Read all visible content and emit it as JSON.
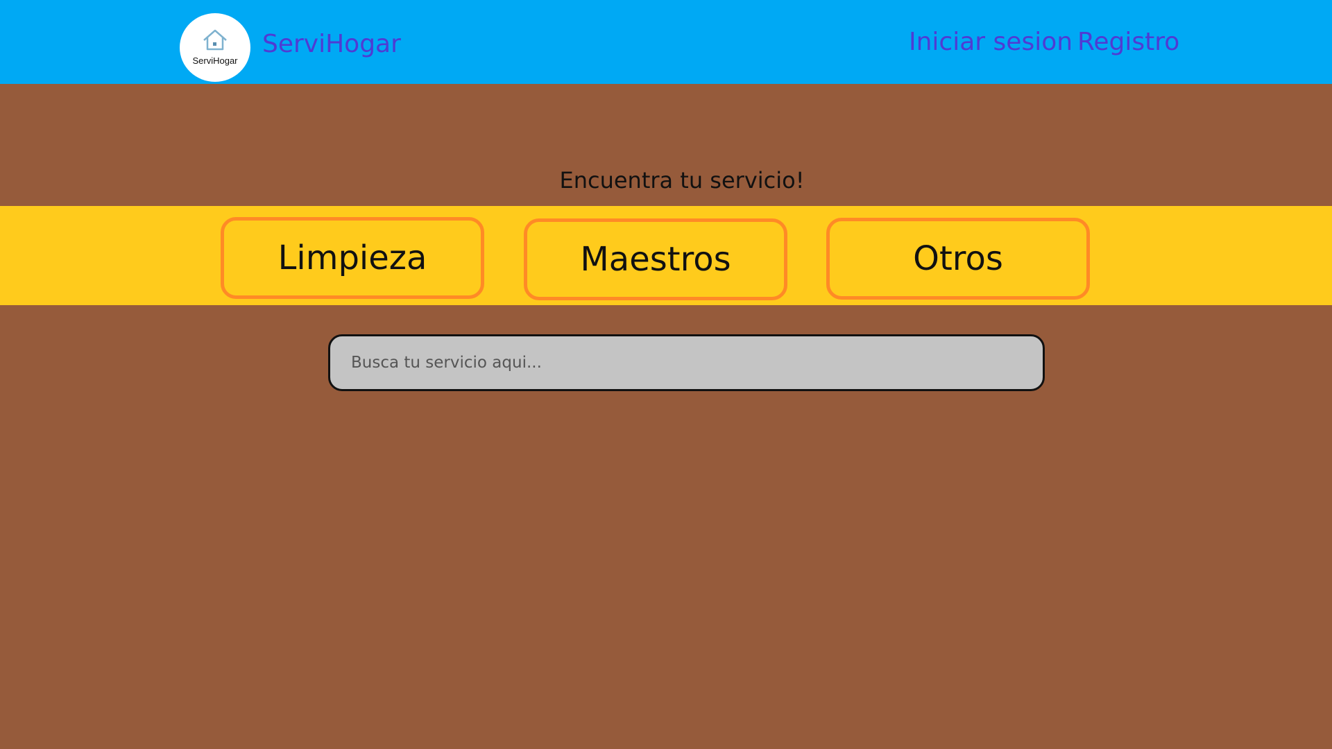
{
  "header": {
    "logo_text": "ServiHogar",
    "brand": "ServiHogar",
    "nav": {
      "login": "Iniciar sesion",
      "register": "Registro"
    }
  },
  "main": {
    "headline": "Encuentra tu servicio!",
    "categories": [
      "Limpieza",
      "Maestros",
      "Otros"
    ],
    "search": {
      "placeholder": "Busca tu servicio aqui...",
      "value": ""
    }
  },
  "colors": {
    "header_bg": "#00a9f4",
    "page_bg": "#965b3b",
    "band_bg": "#ffcb1c",
    "button_border": "#ff8a26",
    "link": "#4f3bd3",
    "search_bg": "#c4c4c4"
  },
  "icons": {
    "logo": "house-icon"
  }
}
